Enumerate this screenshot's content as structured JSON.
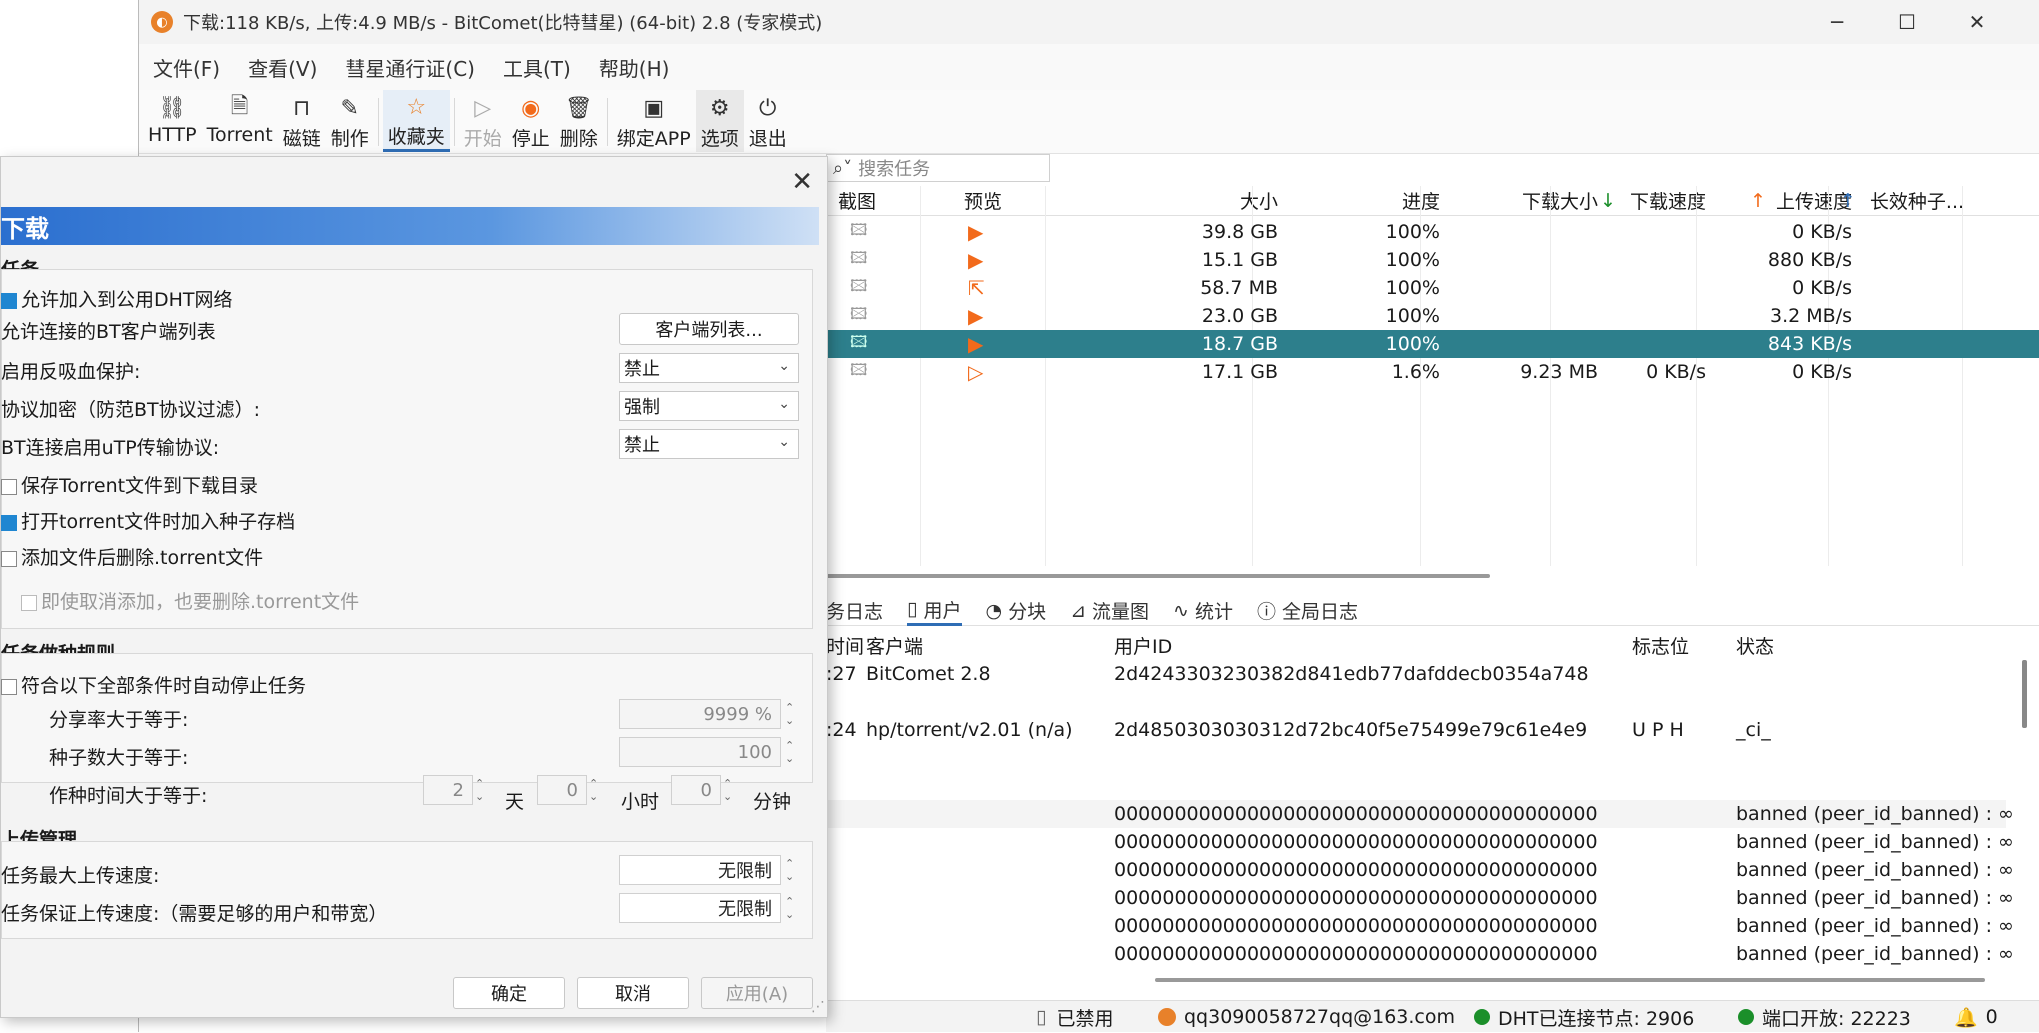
{
  "window": {
    "title": "下载:118 KB/s, 上传:4.9 MB/s - BitComet(比特彗星) (64-bit) 2.8 (专家模式)"
  },
  "menu": [
    "文件(F)",
    "查看(V)",
    "彗星通行证(C)",
    "工具(T)",
    "帮助(H)"
  ],
  "toolbar": {
    "http": "HTTP",
    "torrent": "Torrent",
    "magnet": "磁链",
    "make": "制作",
    "fav": "收藏夹",
    "start": "开始",
    "stop": "停止",
    "delete": "删除",
    "bind": "绑定APP",
    "options": "选项",
    "exit": "退出"
  },
  "search": {
    "placeholder": "搜索任务"
  },
  "task_columns": {
    "shot": "截图",
    "preview": "预览",
    "size": "大小",
    "progress": "进度",
    "dlsize": "下载大小",
    "dlspeed": "下载速度",
    "ulspeed": "上传速度",
    "seed": "长效种子..."
  },
  "tasks": [
    {
      "size": "39.8 GB",
      "progress": "100%",
      "dlsize": "",
      "dlspeed": "",
      "ulspeed": "0 KB/s"
    },
    {
      "size": "15.1 GB",
      "progress": "100%",
      "dlsize": "",
      "dlspeed": "",
      "ulspeed": "880 KB/s"
    },
    {
      "size": "58.7 MB",
      "progress": "100%",
      "dlsize": "",
      "dlspeed": "",
      "ulspeed": "0 KB/s"
    },
    {
      "size": "23.0 GB",
      "progress": "100%",
      "dlsize": "",
      "dlspeed": "",
      "ulspeed": "3.2 MB/s"
    },
    {
      "size": "18.7 GB",
      "progress": "100%",
      "dlsize": "",
      "dlspeed": "",
      "ulspeed": "843 KB/s"
    },
    {
      "size": "17.1 GB",
      "progress": "1.6%",
      "dlsize": "9.23 MB",
      "dlspeed": "0 KB/s",
      "ulspeed": "0 KB/s"
    }
  ],
  "bottom_tabs": {
    "log": "务日志",
    "users": "用户",
    "pieces": "分块",
    "graph": "流量图",
    "stats": "统计",
    "globallog": "全局日志"
  },
  "user_columns": {
    "time": "时间",
    "client": "客户端",
    "peerid": "用户ID",
    "flags": "标志位",
    "state": "状态"
  },
  "users": [
    {
      "time": ":27",
      "client": "BitComet 2.8",
      "peerid": "2d4243303230382d841edb77dafddecb0354a748",
      "flags": "",
      "state": ""
    },
    {
      "time": ":24",
      "client": "hp/torrent/v2.01 (n/a)",
      "peerid": "2d4850303030312d72bc40f5e75499e79c61e4e9",
      "flags": "U P H",
      "state": "_ci_"
    },
    {
      "time": "",
      "client": "",
      "peerid": "0000000000000000000000000000000000000000",
      "flags": "",
      "state": "banned (peer_id_banned) : ∞"
    },
    {
      "time": "",
      "client": "",
      "peerid": "0000000000000000000000000000000000000000",
      "flags": "",
      "state": "banned (peer_id_banned) : ∞"
    },
    {
      "time": "",
      "client": "",
      "peerid": "0000000000000000000000000000000000000000",
      "flags": "",
      "state": "banned (peer_id_banned) : ∞"
    },
    {
      "time": "",
      "client": "",
      "peerid": "0000000000000000000000000000000000000000",
      "flags": "",
      "state": "banned (peer_id_banned) : ∞"
    },
    {
      "time": "",
      "client": "",
      "peerid": "0000000000000000000000000000000000000000",
      "flags": "",
      "state": "banned (peer_id_banned) : ∞"
    },
    {
      "time": "",
      "client": "",
      "peerid": "0000000000000000000000000000000000000000",
      "flags": "",
      "state": "banned (peer_id_banned) : ∞"
    }
  ],
  "status": {
    "disabled": "已禁用",
    "account": "qq3090058727qq@163.com",
    "dht": "DHT已连接节点:  2906",
    "port": "端口开放:  22223",
    "count": "0"
  },
  "dialog": {
    "header": "下载",
    "sec_task": "任务",
    "dht": "允许加入到公用DHT网络",
    "clientlist_label": "允许连接的BT客户端列表",
    "clientlist_btn": "客户端列表...",
    "antileech_label": "启用反吸血保护:",
    "antileech_val": "禁止",
    "encrypt_label": "协议加密（防范BT协议过滤）:",
    "encrypt_val": "强制",
    "utp_label": "BT连接启用uTP传输协议:",
    "utp_val": "禁止",
    "save_torrent": "保存Torrent文件到下载目录",
    "archive": "打开torrent文件时加入种子存档",
    "delete_torrent": "添加文件后删除.torrent文件",
    "cancel_delete": "即使取消添加，也要删除.torrent文件",
    "sec_seed": "任务做种规则",
    "auto_stop": "符合以下全部条件时自动停止任务",
    "ratio_label": "分享率大于等于:",
    "ratio_val": "9999 %",
    "seeds_label": "种子数大于等于:",
    "seeds_val": "100",
    "time_label": "作种时间大于等于:",
    "days_val": "2",
    "days_unit": "天",
    "hours_val": "0",
    "hours_unit": "小时",
    "mins_val": "0",
    "mins_unit": "分钟",
    "sec_upload": "上传管理",
    "maxup_label": "任务最大上传速度:",
    "maxup_val": "无限制",
    "minup_label": "任务保证上传速度:（需要足够的用户和带宽）",
    "minup_val": "无限制",
    "ok": "确定",
    "cancel": "取消",
    "apply": "应用(A)"
  },
  "colors": {
    "accent": "#2d7f8c",
    "play": "#f26a1b",
    "header_blue": "#2b6fcf",
    "dht_green": "#1b8f2a"
  }
}
